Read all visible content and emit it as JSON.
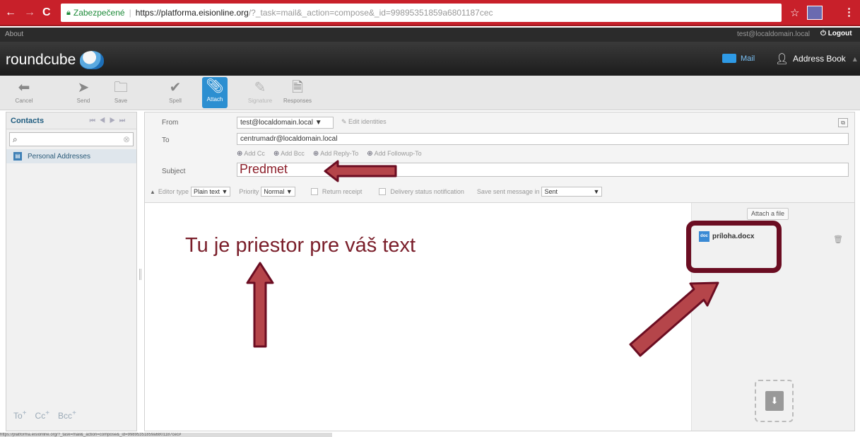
{
  "browser": {
    "back_icon": "←",
    "forward_icon": "→",
    "reload_icon": "C",
    "secure_label": "Zabezpečené",
    "url_host": "https://platforma.eisionline.org",
    "url_rest": "/?_task=mail&_action=compose&_id=99895351859a6801187cec",
    "star_icon": "☆",
    "menu_icon": "⋮"
  },
  "topline": {
    "about": "About",
    "user": "test@localdomain.local",
    "logout": "Logout"
  },
  "header": {
    "logo": "roundcube",
    "mail": "Mail",
    "addressbook": "Address Book"
  },
  "toolbar": {
    "cancel": "Cancel",
    "send": "Send",
    "save": "Save",
    "spell": "Spell",
    "attach": "Attach",
    "signature": "Signature",
    "responses": "Responses"
  },
  "sidebar": {
    "title": "Contacts",
    "search_placeholder": "",
    "addressbook": "Personal Addresses",
    "to": "To",
    "cc": "Cc",
    "bcc": "Bcc"
  },
  "compose": {
    "from_label": "From",
    "from_value": "test@localdomain.local ▼",
    "edit_identities": "Edit identities",
    "to_label": "To",
    "to_value": "centrumadr@localdomain.local",
    "add_cc": "Add Cc",
    "add_bcc": "Add Bcc",
    "add_replyto": "Add Reply-To",
    "add_followupto": "Add Followup-To",
    "subject_label": "Subject",
    "subject_value": "Predmet",
    "editor_type_label": "Editor type",
    "editor_type_value": "Plain text ▼",
    "priority_label": "Priority",
    "priority_value": "Normal ▼",
    "return_receipt": "Return receipt",
    "dsn": "Delivery status notification",
    "save_sent_label": "Save sent message in",
    "save_sent_value": "Sent",
    "body": "Tu je priestor pre váš text"
  },
  "attachments": {
    "attach_button": "Attach a file",
    "file_name": "príloha.docx",
    "file_icon": "doc"
  },
  "status_url": "https://platforma.eisionline.org/?_task=mail&_action=compose&_id=99895351859a6801187cec#",
  "colors": {
    "browser_bar": "#c8202a",
    "annotation": "#7a1e2a",
    "accent": "#2c8fd1"
  }
}
